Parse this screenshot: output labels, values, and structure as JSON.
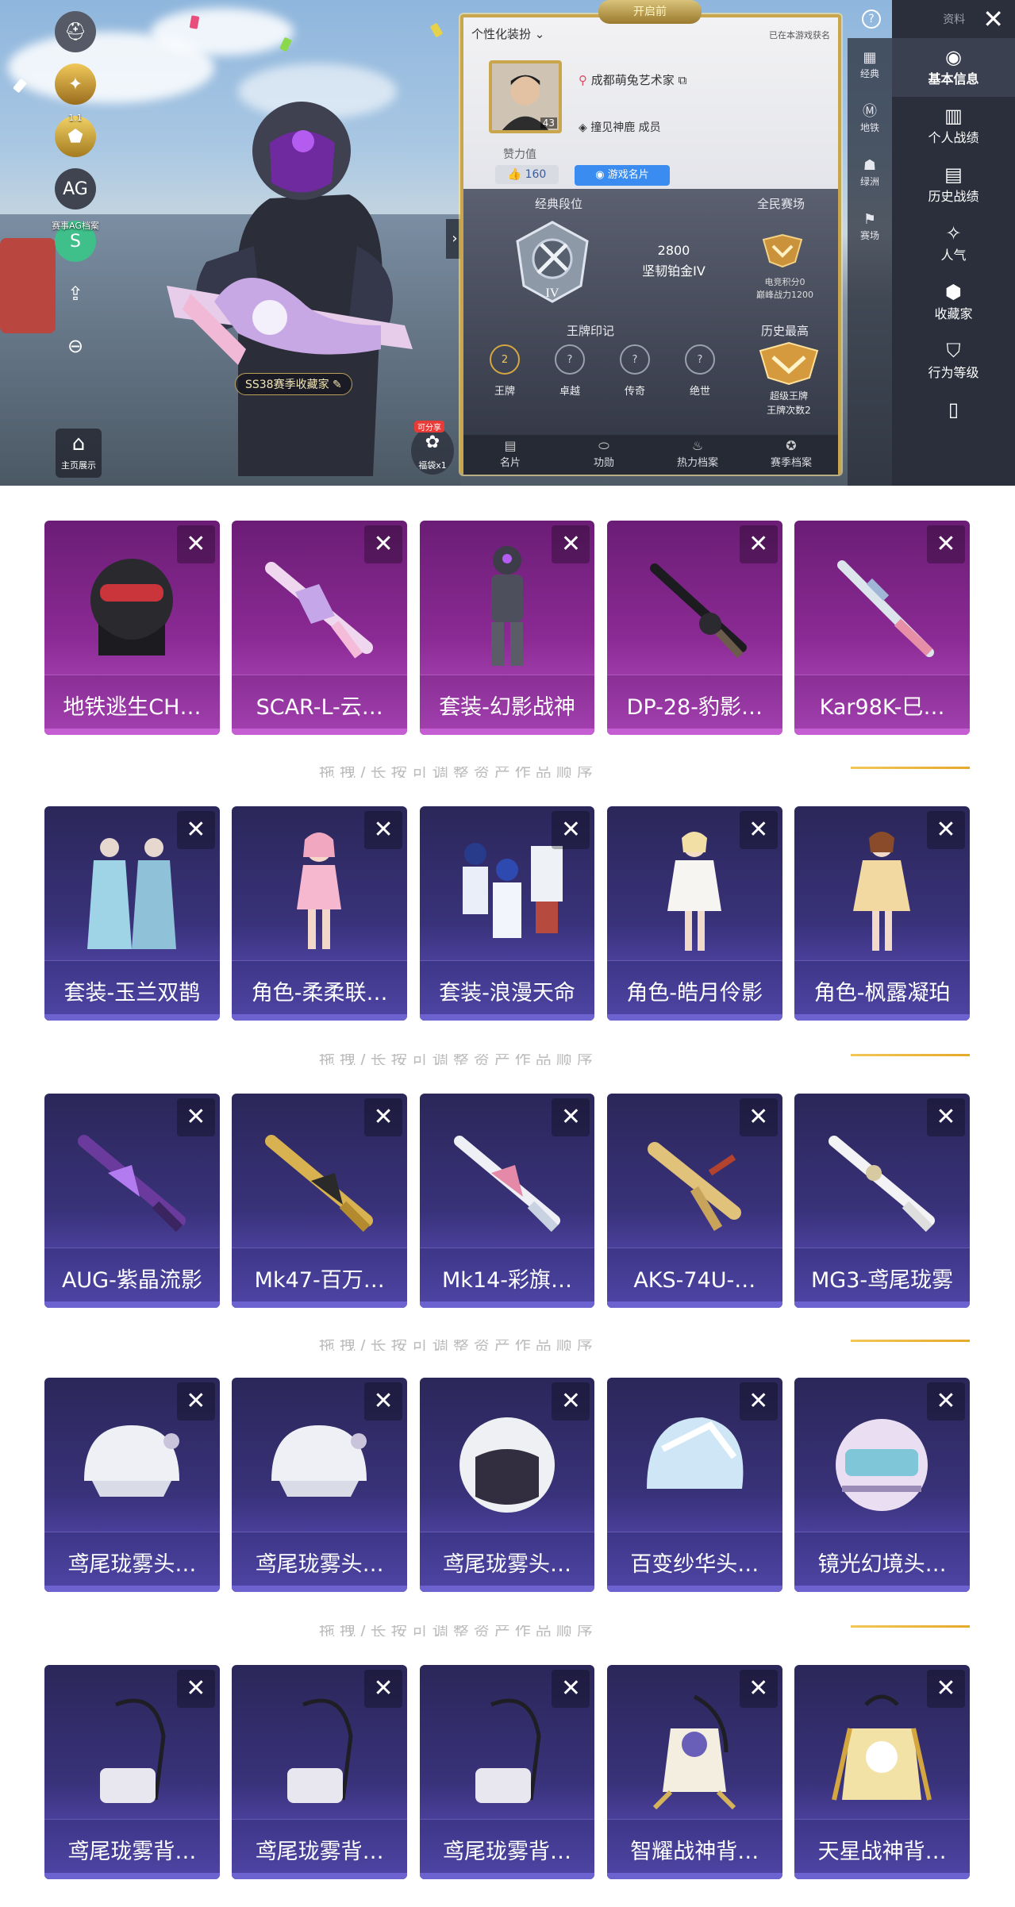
{
  "hero": {
    "panel_title": "个性化装扮",
    "crest_text": "开启前",
    "rank_note": "已在本游戏获名",
    "city": "成都萌兔艺术家",
    "clan": "撞见神鹿 成员",
    "avatar_level": "43",
    "charm_label": "赞力值",
    "charm_value": "160",
    "namecard_button": "游戏名片",
    "classic_rank_label": "经典段位",
    "classic_points": "2800",
    "classic_rank": "坚韧铂金IV",
    "rank_numeral": "IV",
    "all_people_label": "全民赛场",
    "all_people_lines": [
      "电竞积分0",
      "巅峰战力1200"
    ],
    "ace_label": "王牌印记",
    "seals": [
      {
        "label": "王牌",
        "mark": "2"
      },
      {
        "label": "卓越",
        "mark": "?"
      },
      {
        "label": "传奇",
        "mark": "?"
      },
      {
        "label": "绝世",
        "mark": "?"
      }
    ],
    "history_label": "历史最高",
    "history_lines": [
      "超级王牌",
      "王牌次数2"
    ],
    "panel_tabs": [
      "名片",
      "功勋",
      "热力档案",
      "赛季档案"
    ],
    "collector_chip": "SS38赛季收藏家",
    "home_show": "主页展示",
    "share_tag": "可分享",
    "share_text": "福袋x1",
    "left_caption_1": "1.1",
    "left_caption_2": "赛事AG档案",
    "mid_rail": [
      "经典",
      "地铁",
      "绿洲",
      "赛场"
    ],
    "right_rail_top": "资料",
    "right_rail": [
      "基本信息",
      "个人战绩",
      "历史战绩",
      "人气",
      "收藏家",
      "行为等级"
    ],
    "help": "?"
  },
  "separator_text": "拖拽/长按可调整资产作品顺序",
  "groups": [
    {
      "theme": "purple",
      "items": [
        "地铁逃生CH…",
        "SCAR-L-云…",
        "套装-幻影战神",
        "DP-28-豹影…",
        "Kar98K-巳…"
      ],
      "arts": [
        "helmet-mask",
        "rifle-pastel",
        "soldier-dark",
        "lmg-dark",
        "sniper-pastel"
      ]
    },
    {
      "theme": "indigo",
      "items": [
        "套装-玉兰双鹊",
        "角色-柔柔联…",
        "套装-浪漫天命",
        "角色-皓月伶影",
        "角色-枫露凝珀"
      ],
      "arts": [
        "duo-robes",
        "girl-pink",
        "trio-blue",
        "girl-white",
        "girl-gold"
      ]
    },
    {
      "theme": "indigo",
      "items": [
        "AUG-紫晶流影",
        "Mk47-百万…",
        "Mk14-彩旗…",
        "AKS-74U-…",
        "MG3-鸢尾珑雾"
      ],
      "arts": [
        "gun-purple",
        "gun-gold",
        "gun-white",
        "gun-goldsmg",
        "gun-whitelmg"
      ]
    },
    {
      "theme": "indigo",
      "items": [
        "鸢尾珑雾头…",
        "鸢尾珑雾头…",
        "鸢尾珑雾头…",
        "百变纱华头…",
        "镜光幻境头…"
      ],
      "arts": [
        "helmet-white",
        "helmet-white",
        "helmet-round",
        "helmet-ice",
        "helmet-visor"
      ]
    },
    {
      "theme": "indigo",
      "items": [
        "鸢尾珑雾背…",
        "鸢尾珑雾背…",
        "鸢尾珑雾背…",
        "智耀战神背…",
        "天星战神背…"
      ],
      "arts": [
        "bag-white",
        "bag-white",
        "bag-white",
        "bag-ornate",
        "bag-gold"
      ]
    }
  ],
  "close_glyph": "✕",
  "colors": {
    "gold": "#c9a64b",
    "purple": "#8b2a94",
    "indigo": "#39327a"
  }
}
